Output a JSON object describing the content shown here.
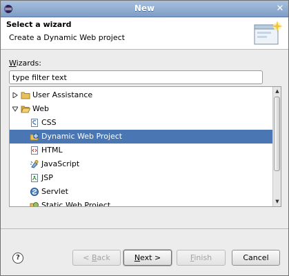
{
  "window": {
    "title": "New"
  },
  "header": {
    "title": "Select a wizard",
    "description": "Create a Dynamic Web project"
  },
  "wizards": {
    "label_prefix": "",
    "mnemonic": "W",
    "label_rest": "izards:"
  },
  "filter": {
    "value": "type filter text"
  },
  "tree": {
    "items": [
      {
        "label": "User Assistance",
        "expanded": false,
        "icon": "folder-icon"
      },
      {
        "label": "Web",
        "expanded": true,
        "icon": "folder-open-icon"
      },
      {
        "label": "CSS",
        "icon": "css-file-icon"
      },
      {
        "label": "Dynamic Web Project",
        "icon": "web-project-icon",
        "selected": true
      },
      {
        "label": "HTML",
        "icon": "html-file-icon"
      },
      {
        "label": "JavaScript",
        "icon": "javascript-icon"
      },
      {
        "label": "JSP",
        "icon": "jsp-file-icon"
      },
      {
        "label": "Servlet",
        "icon": "servlet-icon"
      },
      {
        "label": "Static Web Project",
        "icon": "static-web-project-icon"
      }
    ]
  },
  "buttons": {
    "back": {
      "prefix": "< ",
      "mnemonic": "B",
      "rest": "ack"
    },
    "next": {
      "mnemonic": "N",
      "rest": "ext >"
    },
    "finish": {
      "mnemonic": "F",
      "rest": "inish"
    },
    "cancel": "Cancel"
  },
  "colors": {
    "selection": "#4a77b4",
    "titlebar": "#8eabd2"
  }
}
